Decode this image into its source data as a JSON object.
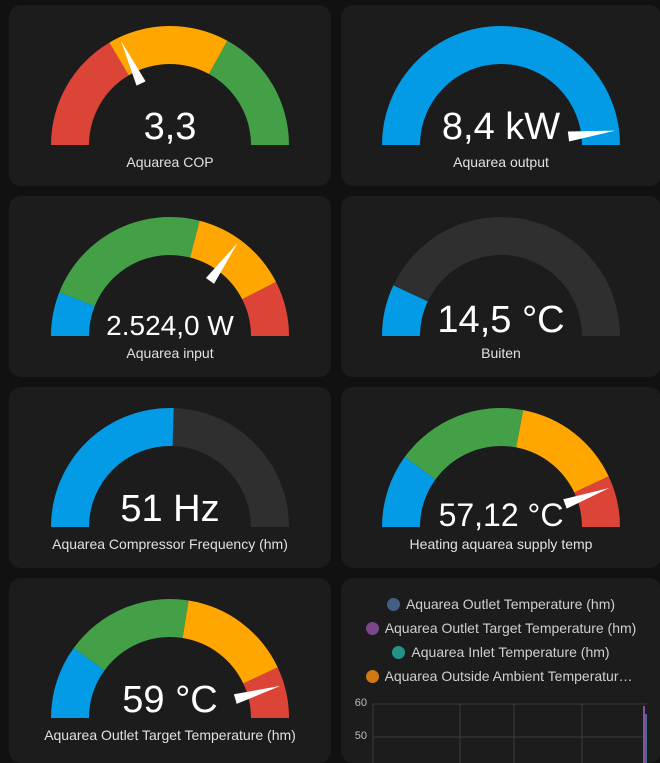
{
  "colors": {
    "background": "#111111",
    "card": "#1c1c1c",
    "gauge_track": "#2f2f2f",
    "red": "#db4437",
    "orange": "#ffa600",
    "green": "#43a047",
    "blue": "#039be5",
    "needle": "#ffffff"
  },
  "gauges": [
    {
      "value_text": "3,3",
      "name": "Aquarea COP",
      "needle_fraction": 0.36,
      "segments": [
        {
          "from": 0.0,
          "to": 0.33,
          "color": "#db4437"
        },
        {
          "from": 0.33,
          "to": 0.66,
          "color": "#ffa600"
        },
        {
          "from": 0.66,
          "to": 1.0,
          "color": "#43a047"
        }
      ]
    },
    {
      "value_text": "8,4 kW",
      "name": "Aquarea output",
      "needle_fraction": 0.96,
      "segments": [
        {
          "from": 0.0,
          "to": 1.0,
          "color": "#039be5"
        }
      ]
    },
    {
      "value_text": "2.524,0 W",
      "name": "Aquarea input",
      "needle_fraction": 0.7,
      "segments": [
        {
          "from": 0.0,
          "to": 0.12,
          "color": "#039be5"
        },
        {
          "from": 0.12,
          "to": 0.58,
          "color": "#43a047"
        },
        {
          "from": 0.58,
          "to": 0.85,
          "color": "#ffa600"
        },
        {
          "from": 0.85,
          "to": 1.0,
          "color": "#db4437"
        }
      ]
    },
    {
      "value_text": "14,5 °C",
      "name": "Buiten",
      "needle_fraction": null,
      "segments": [
        {
          "from": 0.0,
          "to": 0.14,
          "color": "#039be5"
        }
      ]
    },
    {
      "value_text": "51 Hz",
      "name": "Aquarea Compressor Frequency (hm)",
      "needle_fraction": null,
      "segments": [
        {
          "from": 0.0,
          "to": 0.51,
          "color": "#039be5"
        }
      ]
    },
    {
      "value_text": "57,12 °C",
      "name": "Heating aquarea supply temp",
      "needle_fraction": 0.89,
      "segments": [
        {
          "from": 0.0,
          "to": 0.2,
          "color": "#039be5"
        },
        {
          "from": 0.2,
          "to": 0.56,
          "color": "#43a047"
        },
        {
          "from": 0.56,
          "to": 0.86,
          "color": "#ffa600"
        },
        {
          "from": 0.86,
          "to": 1.0,
          "color": "#db4437"
        }
      ]
    },
    {
      "value_text": "59 °C",
      "name": "Aquarea Outlet Target Temperature (hm)",
      "needle_fraction": 0.91,
      "segments": [
        {
          "from": 0.0,
          "to": 0.2,
          "color": "#039be5"
        },
        {
          "from": 0.2,
          "to": 0.55,
          "color": "#43a047"
        },
        {
          "from": 0.55,
          "to": 0.86,
          "color": "#ffa600"
        },
        {
          "from": 0.86,
          "to": 1.0,
          "color": "#db4437"
        }
      ]
    }
  ],
  "history": {
    "legend": [
      {
        "label": "Aquarea Outlet Temperature (hm)",
        "color": "#4a6a95"
      },
      {
        "label": "Aquarea Outlet Target Temperature (hm)",
        "color": "#8a4f9e"
      },
      {
        "label": "Aquarea Inlet Temperature (hm)",
        "color": "#26a69a"
      },
      {
        "label": "Aquarea Outside Ambient Temperature (hm)",
        "color": "#ef8a12"
      }
    ],
    "y_ticks": [
      "60",
      "50"
    ]
  }
}
